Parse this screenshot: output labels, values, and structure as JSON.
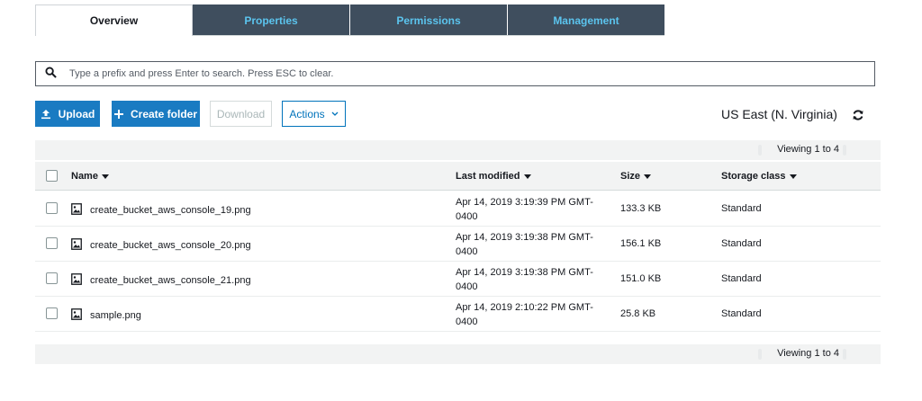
{
  "tabs": [
    {
      "label": "Overview",
      "active": true
    },
    {
      "label": "Properties",
      "active": false
    },
    {
      "label": "Permissions",
      "active": false
    },
    {
      "label": "Management",
      "active": false
    }
  ],
  "search": {
    "placeholder": "Type a prefix and press Enter to search. Press ESC to clear.",
    "icon": "search-icon"
  },
  "toolbar": {
    "upload_label": "Upload",
    "create_folder_label": "Create folder",
    "download_label": "Download",
    "actions_label": "Actions"
  },
  "region": "US East (N. Virginia)",
  "viewing_top": "Viewing 1 to 4",
  "viewing_bottom": "Viewing 1 to 4",
  "columns": {
    "name": "Name",
    "last_modified": "Last modified",
    "size": "Size",
    "storage_class": "Storage class"
  },
  "files": [
    {
      "name": "create_bucket_aws_console_19.png",
      "modified_line1": "Apr 14, 2019 3:19:39 PM GMT-",
      "modified_line2": "0400",
      "size": "133.3 KB",
      "storage": "Standard"
    },
    {
      "name": "create_bucket_aws_console_20.png",
      "modified_line1": "Apr 14, 2019 3:19:38 PM GMT-",
      "modified_line2": "0400",
      "size": "156.1 KB",
      "storage": "Standard"
    },
    {
      "name": "create_bucket_aws_console_21.png",
      "modified_line1": "Apr 14, 2019 3:19:38 PM GMT-",
      "modified_line2": "0400",
      "size": "151.0 KB",
      "storage": "Standard"
    },
    {
      "name": "sample.png",
      "modified_line1": "Apr 14, 2019 2:10:22 PM GMT-",
      "modified_line2": "0400",
      "size": "25.8 KB",
      "storage": "Standard"
    }
  ],
  "colors": {
    "primary": "#1a7bc2",
    "tab_bg": "#3f4e5e",
    "tab_text": "#5bc4ee",
    "link": "#0073bb"
  }
}
